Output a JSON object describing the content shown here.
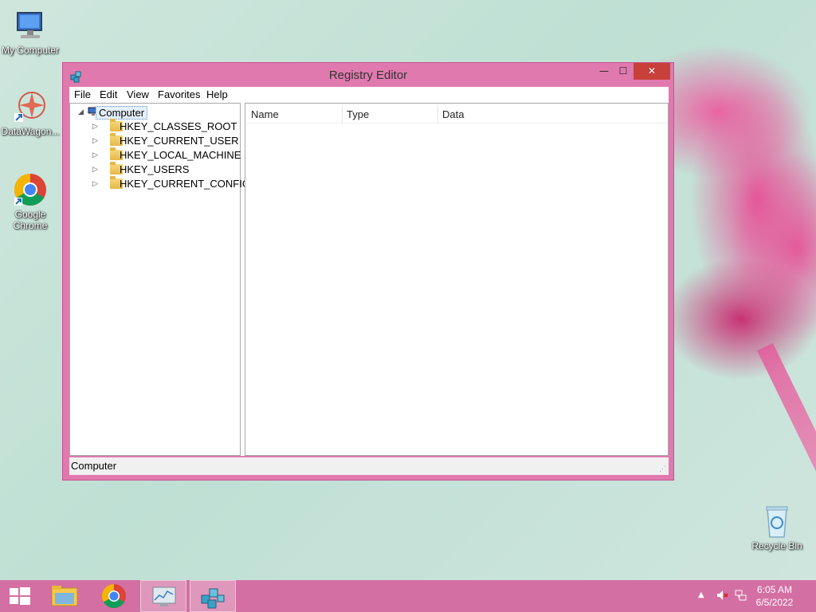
{
  "desktop": {
    "icons": [
      {
        "label": "My Computer"
      },
      {
        "label": "DataWagon..."
      },
      {
        "label": "Google Chrome"
      },
      {
        "label": "Recycle Bin"
      }
    ]
  },
  "window": {
    "title": "Registry Editor",
    "controls": {
      "minimize": "—",
      "maximize": "☐",
      "close": "✕"
    },
    "menu": [
      "File",
      "Edit",
      "View",
      "Favorites",
      "Help"
    ],
    "tree": {
      "root": "Computer",
      "children": [
        "HKEY_CLASSES_ROOT",
        "HKEY_CURRENT_USER",
        "HKEY_LOCAL_MACHINE",
        "HKEY_USERS",
        "HKEY_CURRENT_CONFIG"
      ]
    },
    "list": {
      "columns": [
        "Name",
        "Type",
        "Data"
      ]
    },
    "status": "Computer"
  },
  "taskbar": {
    "time": "6:05 AM",
    "date": "6/5/2022",
    "apps": [
      "start",
      "file-explorer",
      "google-chrome",
      "performance-monitor",
      "registry-editor"
    ]
  }
}
